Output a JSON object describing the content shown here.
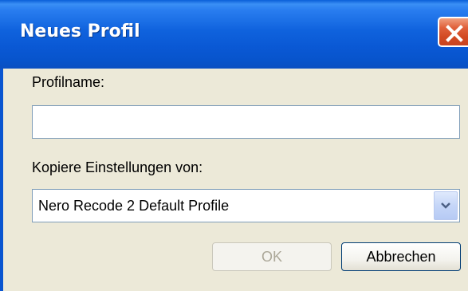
{
  "window": {
    "title": "Neues Profil"
  },
  "form": {
    "profile_name_label": "Profilname:",
    "profile_name_value": "",
    "copy_settings_label": "Kopiere Einstellungen von:",
    "copy_settings_selected": "Nero Recode 2 Default Profile"
  },
  "buttons": {
    "ok_label": "OK",
    "cancel_label": "Abbrechen"
  },
  "icons": {
    "close": "close-icon",
    "dropdown": "chevron-down-icon"
  },
  "colors": {
    "titlebar": "#0a58d4",
    "close_button": "#d24a22",
    "dialog_background": "#ece9d8"
  }
}
